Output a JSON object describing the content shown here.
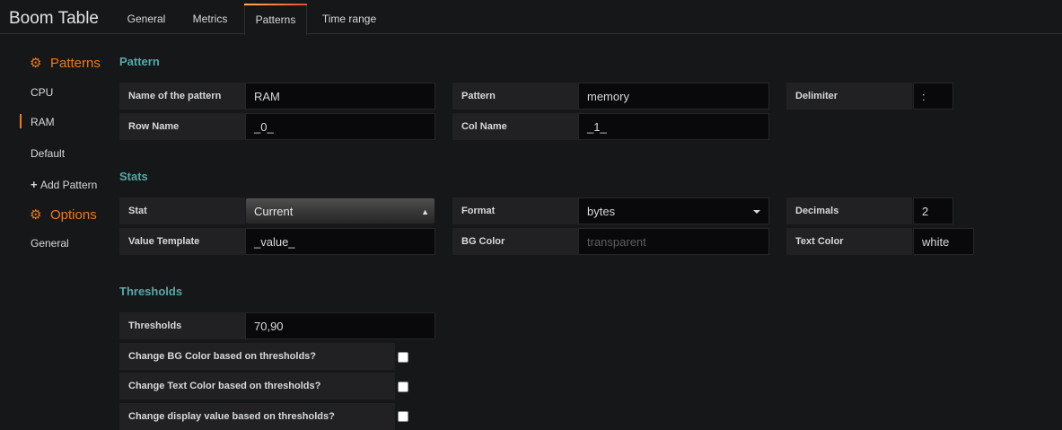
{
  "panel_title": "Boom Table",
  "tabs": [
    {
      "label": "General"
    },
    {
      "label": "Metrics"
    },
    {
      "label": "Patterns",
      "active": true
    },
    {
      "label": "Time range"
    }
  ],
  "sidebar": {
    "patterns_heading": "Patterns",
    "items": [
      "CPU",
      "RAM",
      "Default"
    ],
    "selected": "RAM",
    "add_pattern": "Add Pattern",
    "options_heading": "Options",
    "options_items": [
      "General"
    ]
  },
  "pattern_section": {
    "title": "Pattern",
    "name_label": "Name of the pattern",
    "name_value": "RAM",
    "pattern_label": "Pattern",
    "pattern_value": "memory",
    "delimiter_label": "Delimiter",
    "delimiter_value": ":",
    "row_name_label": "Row Name",
    "row_name_value": "_0_",
    "col_name_label": "Col Name",
    "col_name_value": "_1_"
  },
  "stats_section": {
    "title": "Stats",
    "stat_label": "Stat",
    "stat_value": "Current",
    "format_label": "Format",
    "format_value": "bytes",
    "decimals_label": "Decimals",
    "decimals_value": "2",
    "value_template_label": "Value Template",
    "value_template_value": "_value_",
    "bg_color_label": "BG Color",
    "bg_color_placeholder": "transparent",
    "text_color_label": "Text Color",
    "text_color_value": "white"
  },
  "thresholds_section": {
    "title": "Thresholds",
    "thresholds_label": "Thresholds",
    "thresholds_value": "70,90",
    "checks": [
      {
        "label": "Change BG Color based on thresholds?",
        "checked": false
      },
      {
        "label": "Change Text Color based on thresholds?",
        "checked": false
      },
      {
        "label": "Change display value based on thresholds?",
        "checked": false
      }
    ]
  },
  "colors": {
    "accent_orange": "#eb7b18",
    "section_teal": "#57a8a8",
    "background": "#161719"
  }
}
